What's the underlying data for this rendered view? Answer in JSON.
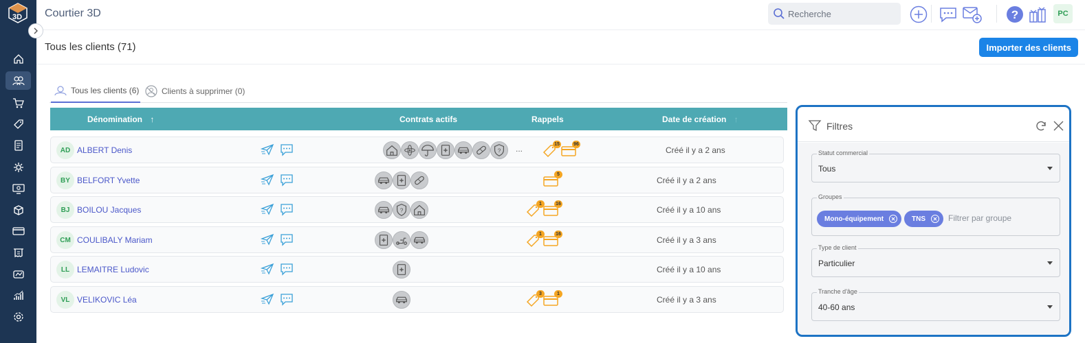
{
  "app": {
    "title": "Courtier 3D",
    "user_initials": "PC"
  },
  "search": {
    "placeholder": "Recherche"
  },
  "header": {
    "page_title": "Tous les clients (71)",
    "import_label": "Importer des clients"
  },
  "tabs": [
    {
      "label": "Tous les clients (6)",
      "active": true
    },
    {
      "label": "Clients à supprimer (0)",
      "active": false
    }
  ],
  "table": {
    "columns": {
      "name": "Dénomination",
      "contracts": "Contrats actifs",
      "reminders": "Rappels",
      "created": "Date de création"
    },
    "rows": [
      {
        "initials": "AD",
        "name": "ALBERT Denis",
        "contracts": [
          "home-icon",
          "atom-icon",
          "umbrella-icon",
          "health-card-icon",
          "car-icon",
          "bandage-icon",
          "shield-question-icon"
        ],
        "more": "...",
        "tag_count": "15",
        "card_count": "96",
        "created": "Créé il y a 2 ans"
      },
      {
        "initials": "BY",
        "name": "BELFORT Yvette",
        "contracts": [
          "car-icon",
          "health-card-icon",
          "bandage-icon"
        ],
        "more": "",
        "tag_count": "",
        "card_count": "5",
        "created": "Créé il y a 2 ans"
      },
      {
        "initials": "BJ",
        "name": "BOILOU Jacques",
        "contracts": [
          "car-icon",
          "shield-question-icon",
          "home-icon"
        ],
        "more": "",
        "tag_count": "1",
        "card_count": "16",
        "created": "Créé il y a 10 ans"
      },
      {
        "initials": "CM",
        "name": "COULIBALY Mariam",
        "contracts": [
          "health-card-icon",
          "scooter-icon",
          "car-icon"
        ],
        "more": "",
        "tag_count": "1",
        "card_count": "16",
        "created": "Créé il y a 3 ans"
      },
      {
        "initials": "LL",
        "name": "LEMAITRE Ludovic",
        "contracts": [
          "health-card-icon"
        ],
        "more": "",
        "tag_count": "",
        "card_count": "",
        "created": "Créé il y a 10 ans"
      },
      {
        "initials": "VL",
        "name": "VELIKOVIC Léa",
        "contracts": [
          "car-icon"
        ],
        "more": "",
        "tag_count": "3",
        "card_count": "1",
        "created": "Créé il y a 3 ans"
      }
    ]
  },
  "filters": {
    "title": "Filtres",
    "statut": {
      "label": "Statut commercial",
      "value": "Tous"
    },
    "groupes": {
      "label": "Groupes",
      "chips": [
        "Mono-équipement",
        "TNS"
      ],
      "placeholder": "Filtrer par groupe"
    },
    "type": {
      "label": "Type de client",
      "value": "Particulier"
    },
    "age": {
      "label": "Tranche d'âge",
      "value": "40-60 ans"
    }
  },
  "colors": {
    "sidebar": "#1d3553",
    "accent": "#1b84e7",
    "table_header": "#4ea9b3",
    "chip": "#6a7ee0",
    "badge": "#f5a623",
    "link": "#4a57c9"
  }
}
